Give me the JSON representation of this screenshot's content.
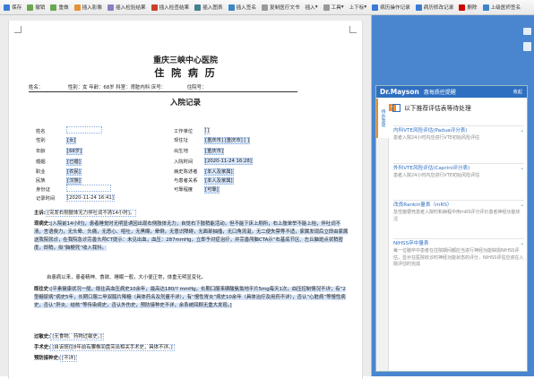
{
  "toolbar": {
    "items": [
      "保存",
      "撤销",
      "重做",
      "插入影像",
      "插入检验结果",
      "插入检查结果",
      "插入图表",
      "插入签名",
      "复制医疗文书",
      "插入",
      "工具",
      "上下标",
      "病历操作记录",
      "病历修改记录",
      "删除",
      "上级医师签名"
    ]
  },
  "document": {
    "hospital": "重庆三峡中心医院",
    "title": "住 院 病 历",
    "header_line": {
      "name_label": "姓名：",
      "name": "",
      "gender_label": "性别：",
      "gender": "女",
      "age_label": "年龄：",
      "age": "68岁",
      "dept_label": "科室：",
      "dept": "肾脏内科",
      "bed_label": "床号：",
      "bed": "",
      "inpatient_label": "住院号：",
      "inpatient_no": ""
    },
    "record_title": "入院记录",
    "fields": [
      {
        "label": "姓名",
        "value": "",
        "label2": "工作单位",
        "value2": "[]"
      },
      {
        "label": "性别",
        "value": "[女]",
        "label2": "现住址",
        "value2": "[重庆市] [重庆市] [             ]"
      },
      {
        "label": "年龄",
        "value": "[68岁]",
        "label2": "出生地",
        "value2": "[重庆市]"
      },
      {
        "label": "婚姻",
        "value": "[已婚]",
        "label2": "入院时间",
        "value2": "[2020-11-24 16:28]"
      },
      {
        "label": "职业",
        "value": "[农民]",
        "label2": "病史陈述者",
        "value2": "[本人及家属]"
      },
      {
        "label": "民族",
        "value": "[汉族]",
        "label2": "与患者关系",
        "value2": "[本人及家属]"
      },
      {
        "label": "身份证",
        "value": "",
        "label2": "可靠程度",
        "value2": "[可靠]"
      },
      {
        "label": "记录时间",
        "value": "[2020-11-24 16:41]",
        "label2": "",
        "value2": ""
      }
    ],
    "chief_label": "主诉:",
    "chief": "[突发右侧肢体无力伴吐词不清14小时]。",
    "hpi_label": "现病史:",
    "hpi_text": "[入院前14小时]，患者睡觉时无明显诱因出现右侧肢体无力，自觉右下肢稍能活动，但不能下床上厕所，右上肢单举不能上抬，伴吐词不清，言语费力，无头晕、头痛，无恶心、呕吐，无黑矇，晕倒，无意识障碍，无面部抽搐，无口角流涎，无二便失禁等不适，家属发现后立即由家属送我院就诊，在我院急诊完善头颅CT提示：未见出血，血压：287mmHg，立即予对症治疗，并完善颅脑CTA示“右基底节区、左丘脑斑点状稍密度，即稍，拟“脑梗死”收入我科。",
    "hpi_text2": "自患病以来，患者精神、食欲、睡眠一般，大小便正常，体重无明显变化。",
    "past_label": "既往史:",
    "past_text": "[平素健康状况一般，既往高血压病史10余年，最高达180/? mmHg，长期口服苯磺酸氨氯地平片5mg每天1次，血压控制情况不详；有“2型糖尿病”病史5年，长期口服二甲双胍片降糖（具体药名及剂量不详），有“慢性胃炎”病史10余年（具体治疗及用药不详），否认“心脏病”等慢性病史，否认“肝炎、结核”等传染病史，否认外伤史，预防接种史不详，余系统回顾无重大发现。]",
    "allergy_label": "过敏史:",
    "allergy": "[无食物、药物过敏史。]",
    "surgery_label": "手术史:",
    "surgery": "[自诉既往8年前有腰椎间盘突出相关手术史，具体不详。]",
    "vaccine_label": "预防接种史:",
    "vaccine": "[不详]"
  },
  "sidebar": {
    "brand": "Dr.Mayson",
    "subtitle": "惠每质控提醒",
    "close": "收起",
    "tab1": "待办事项",
    "tab2": "",
    "badge": "4",
    "heading": "以下推荐评估表等待处理",
    "items": [
      {
        "title": "内科VTE风险评估(Padua评分表)",
        "desc": "患者入院24小时内应进行VTE初始风险评估"
      },
      {
        "title": "外科VTE风险评估(Caprini评分表)",
        "desc": "患者入院24小时内应进行VTE初始风险评估"
      },
      {
        "title": "改良Rankin量表（mRS）",
        "desc": "急性脑梗死患者入院时和病程中用mRS评分评价患者神经功能状况"
      },
      {
        "title": "NIHSS卒中量表",
        "desc": "每一位脑卒中患者在住院期间都应当进行神经功能缺损NIHSS评估，显示在医院收诊时神经功能状态的评分，NIHSS评估应该在入院评估时完成"
      }
    ]
  },
  "colors": {
    "accent": "#2e6fc1",
    "sidebar_bg": "#4a86cf",
    "highlight": "#d7e6fa",
    "badge": "#f08a24"
  }
}
